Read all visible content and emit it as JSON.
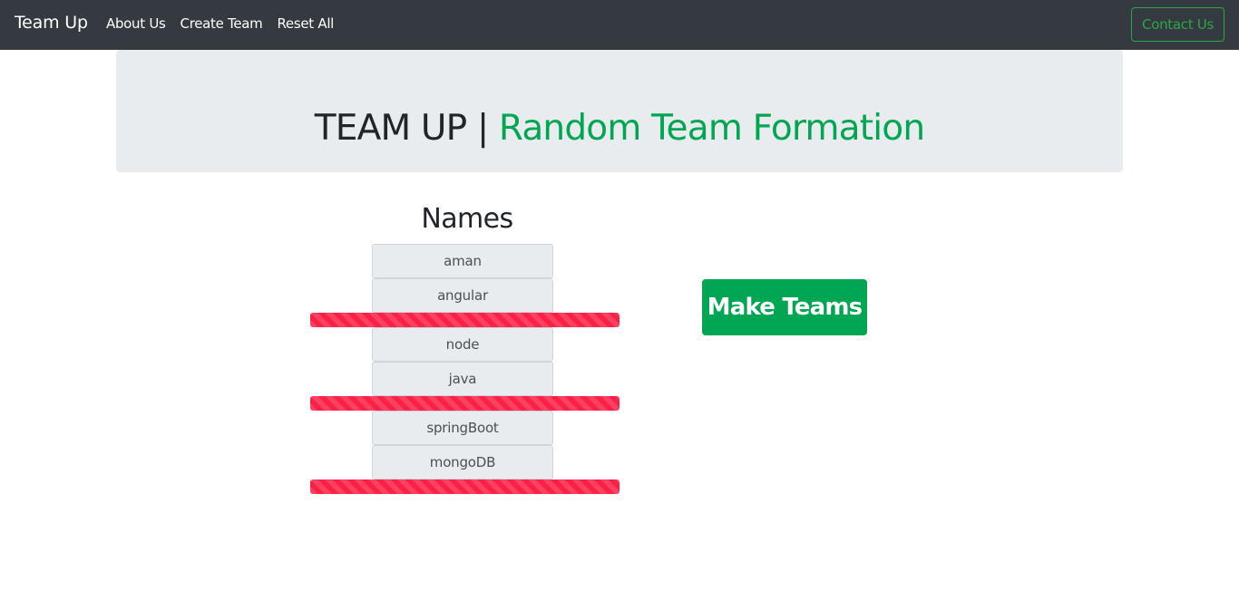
{
  "navbar": {
    "brand": "Team Up",
    "links": [
      "About Us",
      "Create Team",
      "Reset All"
    ],
    "contact_label": "Contact Us"
  },
  "jumbotron": {
    "title_prefix": "TEAM UP | ",
    "title_accent": "Random Team Formation"
  },
  "names": {
    "heading": "Names",
    "items": [
      "aman",
      "angular",
      "node",
      "java",
      "springBoot",
      "mongoDB"
    ]
  },
  "actions": {
    "make_teams_label": "Make Teams"
  },
  "colors": {
    "navbar_bg": "#343a40",
    "accent_green": "#00a651",
    "outline_green": "#28a745",
    "divider_red": "#fa2046",
    "jumbotron_bg": "#e9ecef"
  }
}
